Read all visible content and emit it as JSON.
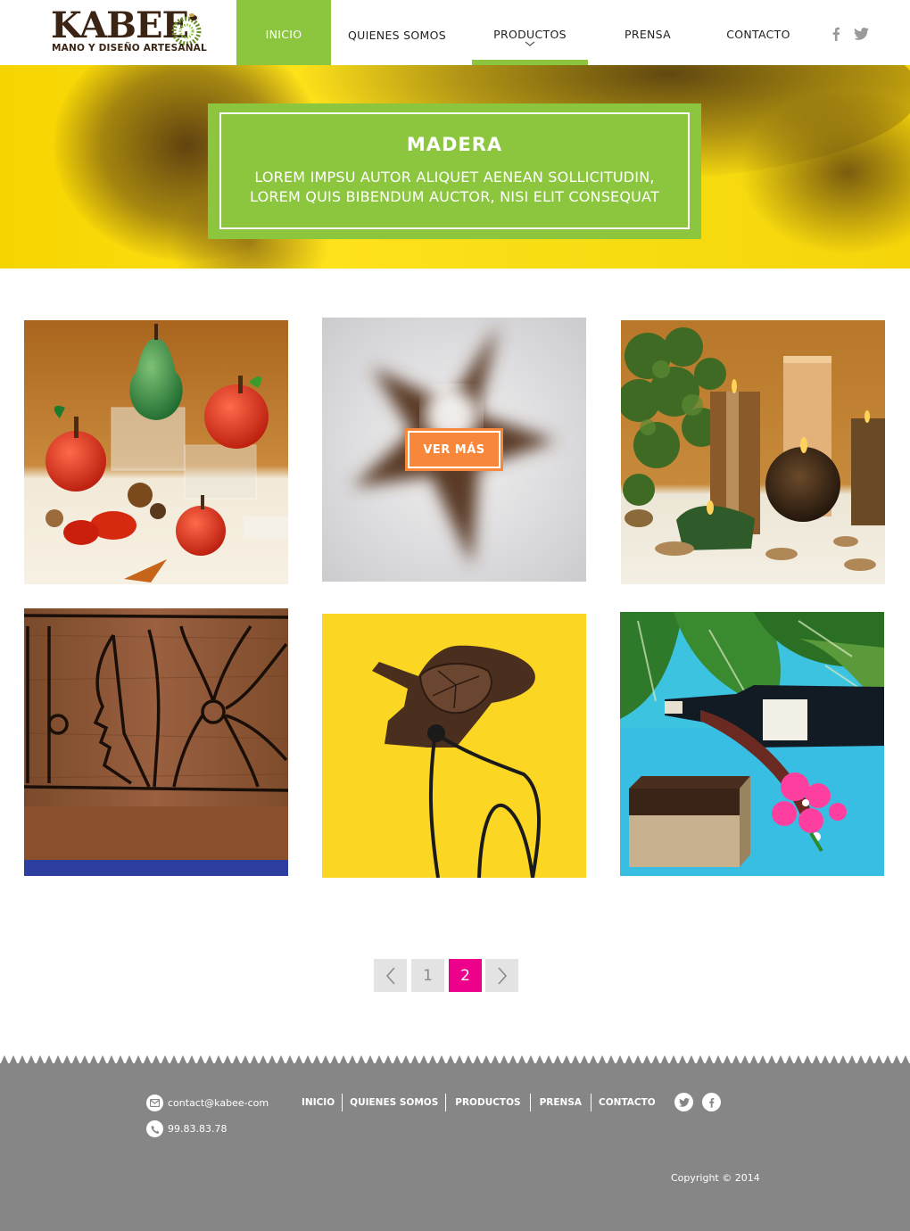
{
  "brand": {
    "name": "KABEE",
    "tagline": "MANO Y DISEÑO ARTESANAL"
  },
  "nav": {
    "items": [
      {
        "label": "INICIO"
      },
      {
        "label": "QUIENES SOMOS"
      },
      {
        "label": "PRODUCTOS"
      },
      {
        "label": "PRENSA"
      },
      {
        "label": "CONTACTO"
      }
    ],
    "active": "INICIO",
    "current": "PRODUCTOS"
  },
  "header_social": [
    "facebook-icon",
    "twitter-icon"
  ],
  "hero": {
    "title": "MADERA",
    "text_line1": "LOREM IMPSU AUTOR ALIQUET AENEAN SOLLICITUDIN,",
    "text_line2": "LOREM QUIS BIBENDUM AUCTOR, NISI ELIT CONSEQUAT"
  },
  "gallery": {
    "hover_button": "VER MÁS",
    "items": [
      "wooden-apples-photo",
      "star-candle-holder-photo",
      "wooden-candles-photo",
      "carved-wood-face-photo",
      "wooden-turtle-pendant-photo",
      "wine-bottle-holder-photo"
    ]
  },
  "pagination": {
    "prev_icon": "chevron-left-icon",
    "pages": [
      "1",
      "2"
    ],
    "current": "2",
    "next_icon": "chevron-right-icon"
  },
  "footer": {
    "email": "contact@kabee-com",
    "phone": "99.83.83.78",
    "nav": [
      "INICIO",
      "QUIENES SOMOS",
      "PRODUCTOS",
      "PRENSA",
      "CONTACTO"
    ],
    "social": [
      "twitter-icon",
      "facebook-icon"
    ],
    "copyright": "Copyright © 2014"
  },
  "colors": {
    "accent_green": "#8cc63f",
    "button_orange": "#f7873a",
    "page_active_pink": "#ec008c",
    "footer_gray": "#868686",
    "logo_brown": "#3b2414"
  }
}
